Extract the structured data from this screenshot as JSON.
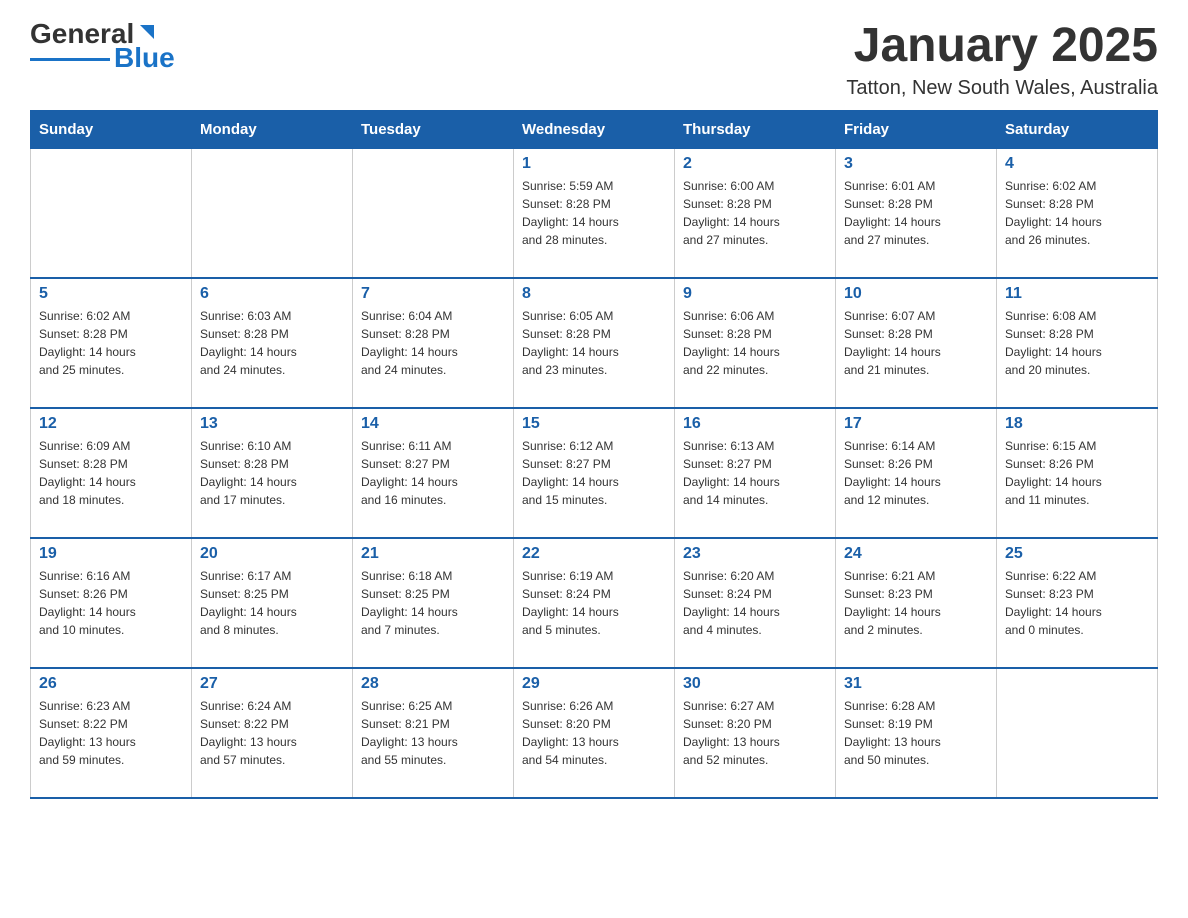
{
  "header": {
    "logo_general": "General",
    "logo_blue": "Blue",
    "title": "January 2025",
    "subtitle": "Tatton, New South Wales, Australia"
  },
  "calendar": {
    "days_of_week": [
      "Sunday",
      "Monday",
      "Tuesday",
      "Wednesday",
      "Thursday",
      "Friday",
      "Saturday"
    ],
    "weeks": [
      [
        {
          "day": "",
          "info": ""
        },
        {
          "day": "",
          "info": ""
        },
        {
          "day": "",
          "info": ""
        },
        {
          "day": "1",
          "info": "Sunrise: 5:59 AM\nSunset: 8:28 PM\nDaylight: 14 hours\nand 28 minutes."
        },
        {
          "day": "2",
          "info": "Sunrise: 6:00 AM\nSunset: 8:28 PM\nDaylight: 14 hours\nand 27 minutes."
        },
        {
          "day": "3",
          "info": "Sunrise: 6:01 AM\nSunset: 8:28 PM\nDaylight: 14 hours\nand 27 minutes."
        },
        {
          "day": "4",
          "info": "Sunrise: 6:02 AM\nSunset: 8:28 PM\nDaylight: 14 hours\nand 26 minutes."
        }
      ],
      [
        {
          "day": "5",
          "info": "Sunrise: 6:02 AM\nSunset: 8:28 PM\nDaylight: 14 hours\nand 25 minutes."
        },
        {
          "day": "6",
          "info": "Sunrise: 6:03 AM\nSunset: 8:28 PM\nDaylight: 14 hours\nand 24 minutes."
        },
        {
          "day": "7",
          "info": "Sunrise: 6:04 AM\nSunset: 8:28 PM\nDaylight: 14 hours\nand 24 minutes."
        },
        {
          "day": "8",
          "info": "Sunrise: 6:05 AM\nSunset: 8:28 PM\nDaylight: 14 hours\nand 23 minutes."
        },
        {
          "day": "9",
          "info": "Sunrise: 6:06 AM\nSunset: 8:28 PM\nDaylight: 14 hours\nand 22 minutes."
        },
        {
          "day": "10",
          "info": "Sunrise: 6:07 AM\nSunset: 8:28 PM\nDaylight: 14 hours\nand 21 minutes."
        },
        {
          "day": "11",
          "info": "Sunrise: 6:08 AM\nSunset: 8:28 PM\nDaylight: 14 hours\nand 20 minutes."
        }
      ],
      [
        {
          "day": "12",
          "info": "Sunrise: 6:09 AM\nSunset: 8:28 PM\nDaylight: 14 hours\nand 18 minutes."
        },
        {
          "day": "13",
          "info": "Sunrise: 6:10 AM\nSunset: 8:28 PM\nDaylight: 14 hours\nand 17 minutes."
        },
        {
          "day": "14",
          "info": "Sunrise: 6:11 AM\nSunset: 8:27 PM\nDaylight: 14 hours\nand 16 minutes."
        },
        {
          "day": "15",
          "info": "Sunrise: 6:12 AM\nSunset: 8:27 PM\nDaylight: 14 hours\nand 15 minutes."
        },
        {
          "day": "16",
          "info": "Sunrise: 6:13 AM\nSunset: 8:27 PM\nDaylight: 14 hours\nand 14 minutes."
        },
        {
          "day": "17",
          "info": "Sunrise: 6:14 AM\nSunset: 8:26 PM\nDaylight: 14 hours\nand 12 minutes."
        },
        {
          "day": "18",
          "info": "Sunrise: 6:15 AM\nSunset: 8:26 PM\nDaylight: 14 hours\nand 11 minutes."
        }
      ],
      [
        {
          "day": "19",
          "info": "Sunrise: 6:16 AM\nSunset: 8:26 PM\nDaylight: 14 hours\nand 10 minutes."
        },
        {
          "day": "20",
          "info": "Sunrise: 6:17 AM\nSunset: 8:25 PM\nDaylight: 14 hours\nand 8 minutes."
        },
        {
          "day": "21",
          "info": "Sunrise: 6:18 AM\nSunset: 8:25 PM\nDaylight: 14 hours\nand 7 minutes."
        },
        {
          "day": "22",
          "info": "Sunrise: 6:19 AM\nSunset: 8:24 PM\nDaylight: 14 hours\nand 5 minutes."
        },
        {
          "day": "23",
          "info": "Sunrise: 6:20 AM\nSunset: 8:24 PM\nDaylight: 14 hours\nand 4 minutes."
        },
        {
          "day": "24",
          "info": "Sunrise: 6:21 AM\nSunset: 8:23 PM\nDaylight: 14 hours\nand 2 minutes."
        },
        {
          "day": "25",
          "info": "Sunrise: 6:22 AM\nSunset: 8:23 PM\nDaylight: 14 hours\nand 0 minutes."
        }
      ],
      [
        {
          "day": "26",
          "info": "Sunrise: 6:23 AM\nSunset: 8:22 PM\nDaylight: 13 hours\nand 59 minutes."
        },
        {
          "day": "27",
          "info": "Sunrise: 6:24 AM\nSunset: 8:22 PM\nDaylight: 13 hours\nand 57 minutes."
        },
        {
          "day": "28",
          "info": "Sunrise: 6:25 AM\nSunset: 8:21 PM\nDaylight: 13 hours\nand 55 minutes."
        },
        {
          "day": "29",
          "info": "Sunrise: 6:26 AM\nSunset: 8:20 PM\nDaylight: 13 hours\nand 54 minutes."
        },
        {
          "day": "30",
          "info": "Sunrise: 6:27 AM\nSunset: 8:20 PM\nDaylight: 13 hours\nand 52 minutes."
        },
        {
          "day": "31",
          "info": "Sunrise: 6:28 AM\nSunset: 8:19 PM\nDaylight: 13 hours\nand 50 minutes."
        },
        {
          "day": "",
          "info": ""
        }
      ]
    ]
  }
}
